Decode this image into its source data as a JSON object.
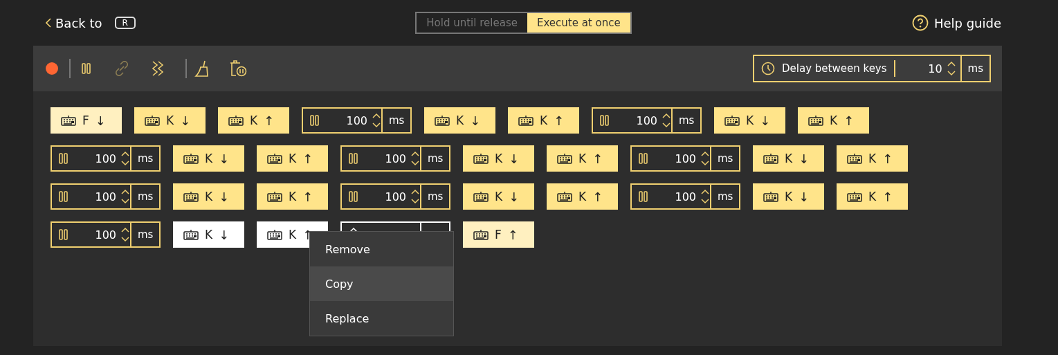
{
  "header": {
    "back": {
      "label": "Back to",
      "key": "R"
    },
    "modes": [
      {
        "label": "Hold until release",
        "selected": false
      },
      {
        "label": "Execute at once",
        "selected": true
      }
    ],
    "help": {
      "label": "Help guide"
    }
  },
  "toolbar": {
    "tool_groups": [
      [
        {
          "kind": "record",
          "disabled": false
        }
      ],
      [
        {
          "kind": "pause",
          "disabled": false
        },
        {
          "kind": "unlink",
          "disabled": true
        },
        {
          "kind": "zigzag",
          "disabled": false
        }
      ],
      [
        {
          "kind": "broom",
          "disabled": false
        },
        {
          "kind": "trash-pause",
          "disabled": false
        }
      ]
    ],
    "delay_between_keys": {
      "label": "Delay between keys",
      "value": "10",
      "unit": "ms"
    }
  },
  "steps": [
    {
      "kind": "key",
      "key": "F",
      "arrow": "↓",
      "boundary": true,
      "selected": false
    },
    {
      "kind": "key",
      "key": "K",
      "arrow": "↓",
      "boundary": false,
      "selected": false
    },
    {
      "kind": "key",
      "key": "K",
      "arrow": "↑",
      "boundary": false,
      "selected": false
    },
    {
      "kind": "delay",
      "value": "100",
      "unit": "ms",
      "selected": false
    },
    {
      "kind": "key",
      "key": "K",
      "arrow": "↓",
      "boundary": false,
      "selected": false
    },
    {
      "kind": "key",
      "key": "K",
      "arrow": "↑",
      "boundary": false,
      "selected": false
    },
    {
      "kind": "delay",
      "value": "100",
      "unit": "ms",
      "selected": false
    },
    {
      "kind": "key",
      "key": "K",
      "arrow": "↓",
      "boundary": false,
      "selected": false
    },
    {
      "kind": "key",
      "key": "K",
      "arrow": "↑",
      "boundary": false,
      "selected": false
    },
    {
      "kind": "delay",
      "value": "100",
      "unit": "ms",
      "selected": false
    },
    {
      "kind": "key",
      "key": "K",
      "arrow": "↓",
      "boundary": false,
      "selected": false
    },
    {
      "kind": "key",
      "key": "K",
      "arrow": "↑",
      "boundary": false,
      "selected": false
    },
    {
      "kind": "delay",
      "value": "100",
      "unit": "ms",
      "selected": false
    },
    {
      "kind": "key",
      "key": "K",
      "arrow": "↓",
      "boundary": false,
      "selected": false
    },
    {
      "kind": "key",
      "key": "K",
      "arrow": "↑",
      "boundary": false,
      "selected": false
    },
    {
      "kind": "delay",
      "value": "100",
      "unit": "ms",
      "selected": false
    },
    {
      "kind": "key",
      "key": "K",
      "arrow": "↓",
      "boundary": false,
      "selected": false
    },
    {
      "kind": "key",
      "key": "K",
      "arrow": "↑",
      "boundary": false,
      "selected": false
    },
    {
      "kind": "delay",
      "value": "100",
      "unit": "ms",
      "selected": false
    },
    {
      "kind": "key",
      "key": "K",
      "arrow": "↓",
      "boundary": false,
      "selected": false
    },
    {
      "kind": "key",
      "key": "K",
      "arrow": "↑",
      "boundary": false,
      "selected": false
    },
    {
      "kind": "delay",
      "value": "100",
      "unit": "ms",
      "selected": false
    },
    {
      "kind": "key",
      "key": "K",
      "arrow": "↓",
      "boundary": false,
      "selected": false
    },
    {
      "kind": "key",
      "key": "K",
      "arrow": "↑",
      "boundary": false,
      "selected": false
    },
    {
      "kind": "delay",
      "value": "100",
      "unit": "ms",
      "selected": false
    },
    {
      "kind": "key",
      "key": "K",
      "arrow": "↓",
      "boundary": false,
      "selected": false
    },
    {
      "kind": "key",
      "key": "K",
      "arrow": "↑",
      "boundary": false,
      "selected": false
    },
    {
      "kind": "delay",
      "value": "100",
      "unit": "ms",
      "selected": false
    },
    {
      "kind": "key",
      "key": "K",
      "arrow": "↓",
      "boundary": false,
      "selected": true
    },
    {
      "kind": "key",
      "key": "K",
      "arrow": "↑",
      "boundary": false,
      "selected": true
    },
    {
      "kind": "delay",
      "selected": true
    },
    {
      "kind": "key",
      "key": "F",
      "arrow": "↑",
      "boundary": true,
      "selected": false
    }
  ],
  "context_menu": {
    "items": [
      {
        "label": "Remove",
        "selected": false
      },
      {
        "label": "Copy",
        "selected": true
      },
      {
        "label": "Replace",
        "selected": false
      }
    ]
  }
}
